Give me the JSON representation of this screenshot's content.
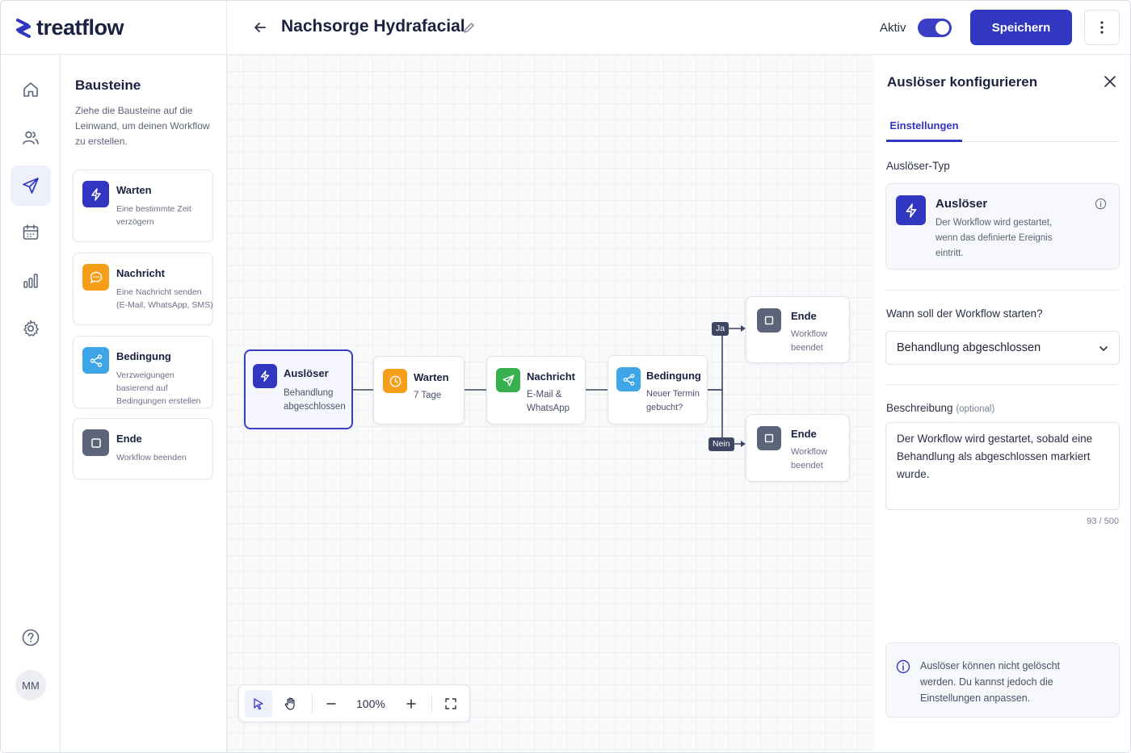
{
  "brand": {
    "name": "treatflow",
    "color": "#3137c0"
  },
  "header": {
    "title": "Nachsorge Hydrafacial",
    "active_label": "Aktiv",
    "active_on": true,
    "save_label": "Speichern"
  },
  "nav": {
    "items": [
      {
        "icon": "home-icon"
      },
      {
        "icon": "users-icon"
      },
      {
        "icon": "send-icon",
        "active": true
      },
      {
        "icon": "calendar-icon"
      },
      {
        "icon": "bar-chart-icon"
      },
      {
        "icon": "gear-icon"
      }
    ],
    "help_icon": "help-icon",
    "avatar_initials": "MM"
  },
  "palette": {
    "title": "Bausteine",
    "description": "Ziehe die Bausteine auf die Leinwand, um deinen Workflow zu erstellen.",
    "blocks": [
      {
        "name": "Warten",
        "desc": "Eine bestimmte Zeit verzögern",
        "icon": "lightning-icon",
        "color": "#3137c0"
      },
      {
        "name": "Nachricht",
        "desc": "Eine Nachricht senden (E-Mail, WhatsApp, SMS)",
        "icon": "message-icon",
        "color": "#f59e1a"
      },
      {
        "name": "Bedingung",
        "desc": "Verzweigungen basierend auf Bedingungen erstellen",
        "icon": "share-icon",
        "color": "#3ea6e6"
      },
      {
        "name": "Ende",
        "desc": "Workflow beenden",
        "icon": "stop-icon",
        "color": "#5b6478"
      }
    ]
  },
  "canvas": {
    "nodes": {
      "trigger": {
        "title": "Auslöser",
        "sub": "Behandlung abgeschlossen",
        "icon": "lightning-icon",
        "color": "#3137c0"
      },
      "wait": {
        "title": "Warten",
        "sub": "7 Tage",
        "icon": "clock-icon",
        "color": "#f59e1a"
      },
      "message": {
        "title": "Nachricht",
        "sub": "E-Mail & WhatsApp",
        "icon": "send-icon",
        "color": "#36b14e"
      },
      "condition": {
        "title": "Bedingung",
        "sub": "Neuer Termin gebucht?",
        "icon": "share-icon",
        "color": "#3ea6e6"
      },
      "end_yes": {
        "title": "Ende",
        "sub": "Workflow beendet",
        "icon": "stop-icon",
        "color": "#5b6478"
      },
      "end_no": {
        "title": "Ende",
        "sub": "Workflow beendet",
        "icon": "stop-icon",
        "color": "#5b6478"
      }
    },
    "branch_yes": "Ja",
    "branch_no": "Nein",
    "toolbar": {
      "zoom": "100%"
    }
  },
  "config": {
    "title": "Auslöser konfigurieren",
    "tab": "Einstellungen",
    "type_label": "Auslöser-Typ",
    "type_name": "Auslöser",
    "type_desc": "Der Workflow wird gestartet, wenn das definierte Ereignis eintritt.",
    "start_label": "Wann soll der Workflow starten?",
    "start_value": "Behandlung abgeschlossen",
    "desc_label": "Beschreibung",
    "desc_optional": "(optional)",
    "desc_value": "Der Workflow wird gestartet, sobald eine Behandlung als abgeschlossen markiert wurde.",
    "counter": "93 / 500",
    "info_text": "Auslöser können nicht gelöscht werden. Du kannst jedoch die Einstellungen anpassen."
  }
}
